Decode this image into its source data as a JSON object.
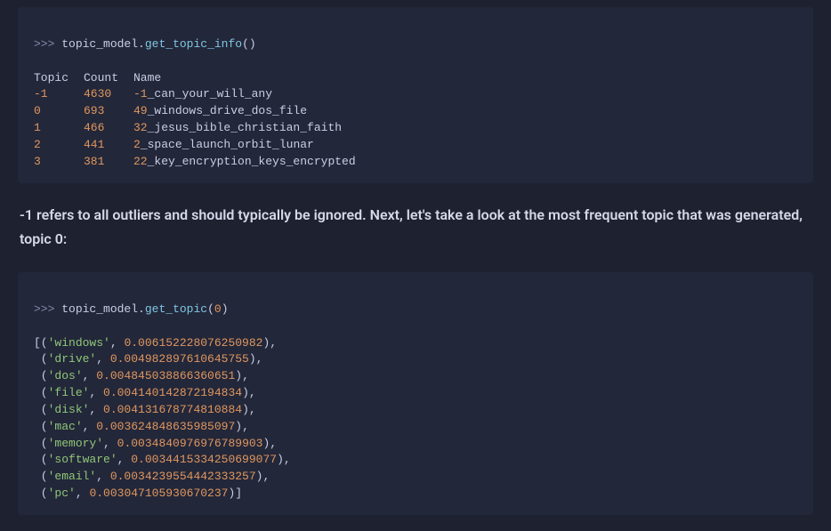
{
  "code1": {
    "prompt": ">>> ",
    "obj": "topic_model",
    "dot": ".",
    "method": "get_topic_info",
    "args_open": "(",
    "args_close": ")",
    "header": {
      "topic": "Topic",
      "count": "Count",
      "name": "Name"
    },
    "rows": [
      {
        "topic": "-1",
        "count": "4630",
        "prefix": "-1",
        "name": "_can_your_will_any"
      },
      {
        "topic": "0",
        "count": "693",
        "prefix": "49",
        "name": "_windows_drive_dos_file"
      },
      {
        "topic": "1",
        "count": "466",
        "prefix": "32",
        "name": "_jesus_bible_christian_faith"
      },
      {
        "topic": "2",
        "count": "441",
        "prefix": "2",
        "name": "_space_launch_orbit_lunar"
      },
      {
        "topic": "3",
        "count": "381",
        "prefix": "22",
        "name": "_key_encryption_keys_encrypted"
      }
    ]
  },
  "paragraph": "-1 refers to all outliers and should typically be ignored. Next, let's take a look at the most frequent topic that was generated, topic 0:",
  "code2": {
    "prompt": ">>> ",
    "obj": "topic_model",
    "dot": ".",
    "method": "get_topic",
    "args_open": "(",
    "arg": "0",
    "args_close": ")",
    "open_bracket": "[(",
    "items": [
      {
        "word": "'windows'",
        "sep": ", ",
        "val": "0.006152228076250982",
        "close": "),"
      },
      {
        "word": "'drive'",
        "sep": ", ",
        "val": "0.004982897610645755",
        "close": "),"
      },
      {
        "word": "'dos'",
        "sep": ", ",
        "val": "0.004845038866360651",
        "close": "),"
      },
      {
        "word": "'file'",
        "sep": ", ",
        "val": "0.004140142872194834",
        "close": "),"
      },
      {
        "word": "'disk'",
        "sep": ", ",
        "val": "0.004131678774810884",
        "close": "),"
      },
      {
        "word": "'mac'",
        "sep": ", ",
        "val": "0.003624848635985097",
        "close": "),"
      },
      {
        "word": "'memory'",
        "sep": ", ",
        "val": "0.0034840976976789903",
        "close": "),"
      },
      {
        "word": "'software'",
        "sep": ", ",
        "val": "0.0034415334250699077",
        "close": "),"
      },
      {
        "word": "'email'",
        "sep": ", ",
        "val": "0.0034239554442333257",
        "close": "),"
      },
      {
        "word": "'pc'",
        "sep": ", ",
        "val": "0.003047105930670237",
        "close": ")]"
      }
    ]
  }
}
